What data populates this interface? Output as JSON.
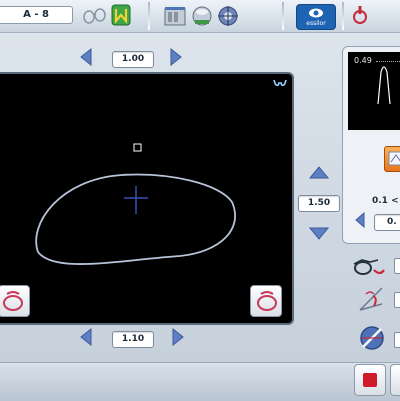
{
  "toolbar": {
    "job_label": "A - 8",
    "brand": "essilor"
  },
  "display": {
    "top_value": "1.00",
    "bottom_value": "1.10",
    "side_value": "1.50"
  },
  "right_panel": {
    "graph_value": "0.49",
    "range_label": "0.1 <",
    "field_value": "0."
  },
  "icons": [
    "glasses-outline-icon",
    "frame-shape-icon",
    "tray-icon",
    "lens-icon",
    "target-icon",
    "essilor-logo-icon",
    "alert-icon",
    "pliers-icon",
    "measure-angle-icon",
    "drill-icon",
    "stop-icon"
  ],
  "colors": {
    "accent_red": "#d01a2a",
    "arrow_blue": "#5d7fc4",
    "trace_line": "#b8c4d8",
    "center_cross": "#3c4fb8"
  }
}
